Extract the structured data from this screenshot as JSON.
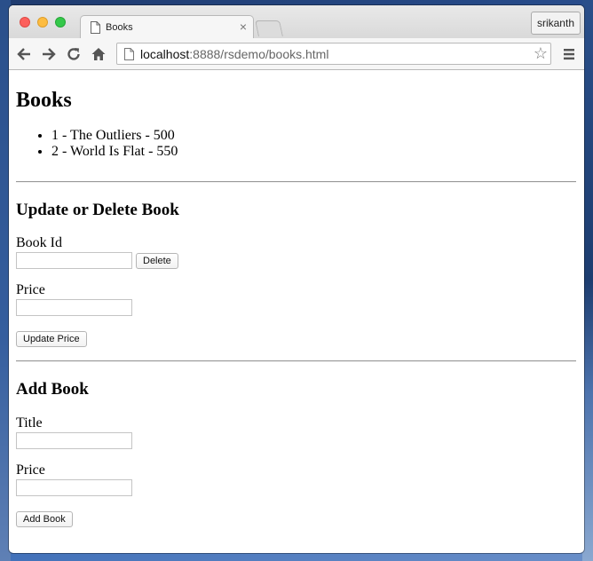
{
  "browser": {
    "tab_title": "Books",
    "profile_name": "srikanth",
    "url_host": "localhost",
    "url_path": ":8888/rsdemo/books.html",
    "icons": [
      "back-icon",
      "forward-icon",
      "reload-icon",
      "home-icon",
      "page-icon",
      "star-icon",
      "menu-icon",
      "close-icon"
    ]
  },
  "page": {
    "heading": "Books",
    "books": [
      "1 - The Outliers - 500",
      "2 - World Is Flat - 550"
    ],
    "update_section": {
      "heading": "Update or Delete Book",
      "book_id_label": "Book Id",
      "book_id_value": "",
      "delete_label": "Delete",
      "price_label": "Price",
      "price_value": "",
      "update_label": "Update Price"
    },
    "add_section": {
      "heading": "Add Book",
      "title_label": "Title",
      "title_value": "",
      "price_label": "Price",
      "price_value": "",
      "add_label": "Add Book"
    }
  },
  "colors": {
    "close": "#fc605c",
    "minimize": "#fdbc40",
    "maximize": "#34c84a"
  }
}
